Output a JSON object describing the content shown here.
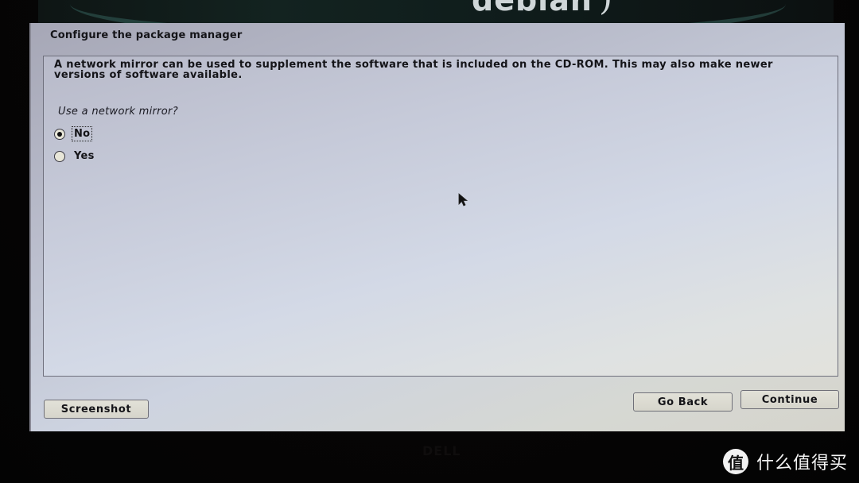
{
  "banner": {
    "logo_text": "debian",
    "logo_swirl": ")"
  },
  "window": {
    "title": "Configure the package manager",
    "description": "A network mirror can be used to supplement the software that is included on the CD-ROM. This may also make newer versions of software available.",
    "question": "Use a network mirror?",
    "options": [
      {
        "label": "No",
        "selected": true
      },
      {
        "label": "Yes",
        "selected": false
      }
    ]
  },
  "buttons": {
    "screenshot": "Screenshot",
    "go_back": "Go Back",
    "continue": "Continue"
  },
  "monitor": {
    "brand": "DELL"
  },
  "watermark": {
    "icon_glyph": "值",
    "text": "什么值得买"
  },
  "colors": {
    "window_bg": "#c6cad9",
    "text": "#141418",
    "bezel": "#050404"
  }
}
